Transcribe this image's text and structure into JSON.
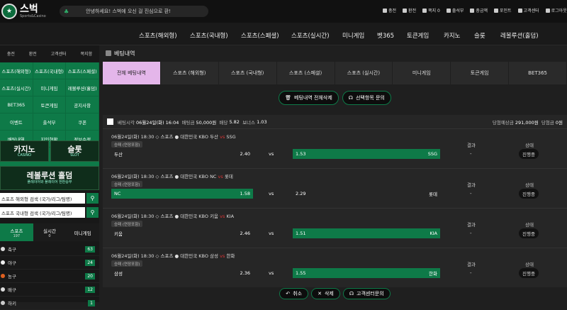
{
  "brand": {
    "name": "스벅",
    "sub": "Sports&Casino"
  },
  "notice": "안녕하세요! 스벅에 오신 걸 진심으로 환!",
  "util": [
    "충전",
    "환전",
    "쪽지 0",
    "출석부",
    "충금액",
    "포인트",
    "고객센터",
    "로그아웃"
  ],
  "nav": [
    "스포츠(해외형)",
    "스포츠(국내형)",
    "스포츠(스페셜)",
    "스포츠(실시간)",
    "미니게임",
    "벳365",
    "토큰게임",
    "카지노",
    "슬롯",
    "레볼루션(홀덤)"
  ],
  "side": {
    "util": [
      "충전",
      "환전",
      "고객센터",
      "쪽지함"
    ],
    "grid": [
      "스포츠(해외형)",
      "스포츠(국내형)",
      "스포츠(스페셜)",
      "스포츠(실시간)",
      "미니게임",
      "레볼루션(홀덤)",
      "BET365",
      "토큰게임",
      "공지사항",
      "이벤트",
      "출석부",
      "쿠폰",
      "배팅내역",
      "지인현황",
      "정보수정",
      "",
      "",
      "",
      "",
      "",
      ""
    ],
    "banners": {
      "casino": "카지노",
      "casino_sub": "CASINO",
      "slot": "슬롯",
      "slot_sub": "SLOT",
      "revo": "레볼루션 홀덤",
      "revo_sub": "플레이어와 플레이어 한판승부"
    },
    "search1": "스포츠 해외형 검색 (국가/리그/팀명)",
    "search2": "스포츠 국내형 검색 (국가/리그/팀명)",
    "tabs": [
      {
        "label": "스포츠",
        "count": "197"
      },
      {
        "label": "실시간",
        "count": "0"
      },
      {
        "label": "미니게임",
        "count": ""
      }
    ],
    "sports": [
      {
        "name": "축구",
        "count": "63",
        "color": "#ddd"
      },
      {
        "name": "야구",
        "count": "24",
        "color": "#eee"
      },
      {
        "name": "농구",
        "count": "20",
        "color": "#e06020"
      },
      {
        "name": "배구",
        "count": "12",
        "color": "#ddd"
      },
      {
        "name": "하키",
        "count": "1",
        "color": "#ccc"
      }
    ]
  },
  "content": {
    "title": "베팅내역",
    "tabs": [
      "전체 베팅내역",
      "스포츠 (해외형)",
      "스포츠 (국내형)",
      "스포츠 (스페셜)",
      "스포츠 (실시간)",
      "미니게임",
      "토큰게임",
      "BET365"
    ],
    "actions": {
      "delete_all": "베팅내역 전체삭제",
      "inquiry": "선택항목 문의"
    },
    "bet": {
      "head": {
        "time_label": "베팅시각",
        "time": "06월24일(화) 16:04",
        "amount_label": "배팅금",
        "amount": "50,000원",
        "odds_label": "배당",
        "odds": "5.82",
        "bonus_label": "보너스",
        "bonus": "1.03",
        "expected_label": "당첨예상금",
        "expected": "291,000원",
        "won_label": "당첨금",
        "won": "0원"
      },
      "games": [
        {
          "info": "06월24일(화) 18:30",
          "sport": "스포츠",
          "league": "대한민국 KBO",
          "home": "두산",
          "away": "SSG",
          "market": "승패 (연장포함)",
          "home_odds": "2.40",
          "draw": "vs",
          "away_odds": "1.53",
          "pick": "away",
          "result": "-",
          "status": "진행중"
        },
        {
          "info": "06월24일(화) 18:30",
          "sport": "스포츠",
          "league": "대한민국 KBO",
          "home": "NC",
          "away": "롯데",
          "market": "승패 (연장포함)",
          "home_odds": "1.58",
          "draw": "vs",
          "away_odds": "2.29",
          "pick": "home",
          "result": "-",
          "status": "진행중"
        },
        {
          "info": "06월24일(화) 18:30",
          "sport": "스포츠",
          "league": "대한민국 KBO",
          "home": "키움",
          "away": "KIA",
          "market": "승패 (연장포함)",
          "home_odds": "2.46",
          "draw": "vs",
          "away_odds": "1.51",
          "pick": "away",
          "result": "-",
          "status": "진행중"
        },
        {
          "info": "06월24일(화) 18:30",
          "sport": "스포츠",
          "league": "대한민국 KBO",
          "home": "삼성",
          "away": "한화",
          "market": "승패 (연장포함)",
          "home_odds": "2.36",
          "draw": "vs",
          "away_odds": "1.55",
          "pick": "away",
          "result": "-",
          "status": "진행중"
        }
      ],
      "col_result": "결과",
      "col_status": "상태"
    },
    "bottom": {
      "cancel": "취소",
      "delete": "삭제",
      "support": "고객센터문의"
    }
  }
}
